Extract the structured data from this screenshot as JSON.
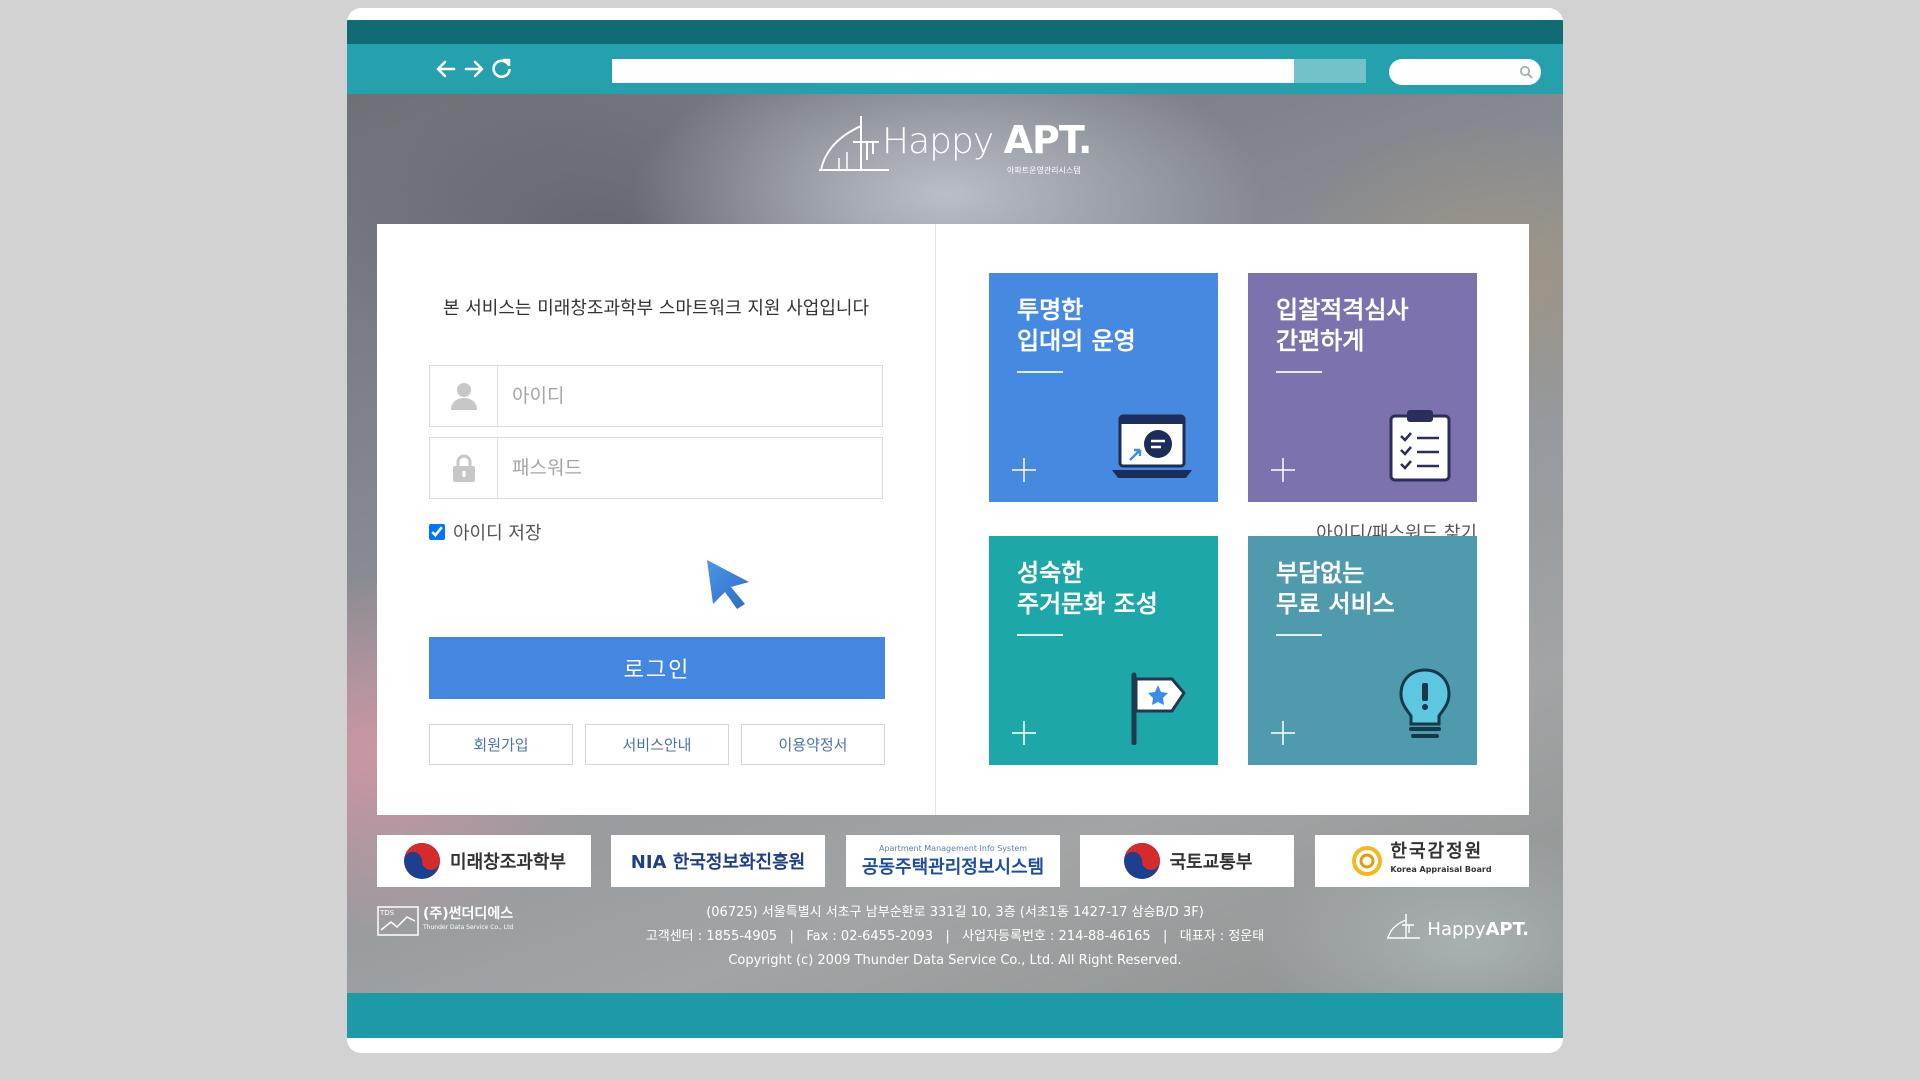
{
  "browser": {
    "icons": [
      "back-arrow-icon",
      "forward-arrow-icon",
      "refresh-icon",
      "search-icon"
    ],
    "address_value": "",
    "search_value": ""
  },
  "header": {
    "logo_happy": "Happy ",
    "logo_apt": "APT.",
    "logo_sub": "아파트운영관리시스템"
  },
  "login": {
    "notice": "본 서비스는 미래창조과학부 스마트워크 지원 사업입니다",
    "id_placeholder": "아이디",
    "pw_placeholder": "패스워드",
    "remember_label": "아이디 저장",
    "remember_checked": true,
    "find_label": "아이디/패스워드 찾기",
    "login_label": "로그인",
    "sub_buttons": [
      "회원가입",
      "서비스안내",
      "이용약정서"
    ]
  },
  "tiles": [
    {
      "title": "투명한\n입대의 운영",
      "color": "#4589e1",
      "icon": "laptop-chat-icon"
    },
    {
      "title": "입찰적격심사\n간편하게",
      "color": "#7b72ae",
      "icon": "clipboard-checklist-icon"
    },
    {
      "title": "성숙한\n주거문화 조성",
      "color": "#1ea7a8",
      "icon": "flag-star-icon"
    },
    {
      "title": "부담없는\n무료 서비스",
      "color": "#4f9aad",
      "icon": "lightbulb-icon"
    }
  ],
  "partners": [
    {
      "name": "미래창조과학부"
    },
    {
      "name": "NIA 한국정보화진흥원"
    },
    {
      "name": "공동주택관리정보시스템",
      "tag": "Apartment Management Info System"
    },
    {
      "name": "국토교통부"
    },
    {
      "name": "한국감정원",
      "tag": "Korea Appraisal Board"
    }
  ],
  "footer": {
    "company_logo": "(주)썬더디에스",
    "company_logo_sub": "Thunder Data Service Co., Ltd",
    "company_mark": "TDS",
    "address": "(06725) 서울특별시 서초구 남부순환로 331길 10, 3층 (서초1동 1427-17 삼승B/D 3F)",
    "contact": "고객센터 : 1855-4905   |   Fax : 02-6455-2093   |   사업자등록번호 : 214-88-46165   |   대표자 : 정운태",
    "copyright": "Copyright (c) 2009 Thunder Data Service Co., Ltd. All Right Reserved.",
    "logo_right_happy": "Happy",
    "logo_right_apt": "APT."
  },
  "colors": {
    "teal_dark": "#0f6c74",
    "teal": "#24a1ac",
    "login_blue": "#4487e0"
  }
}
